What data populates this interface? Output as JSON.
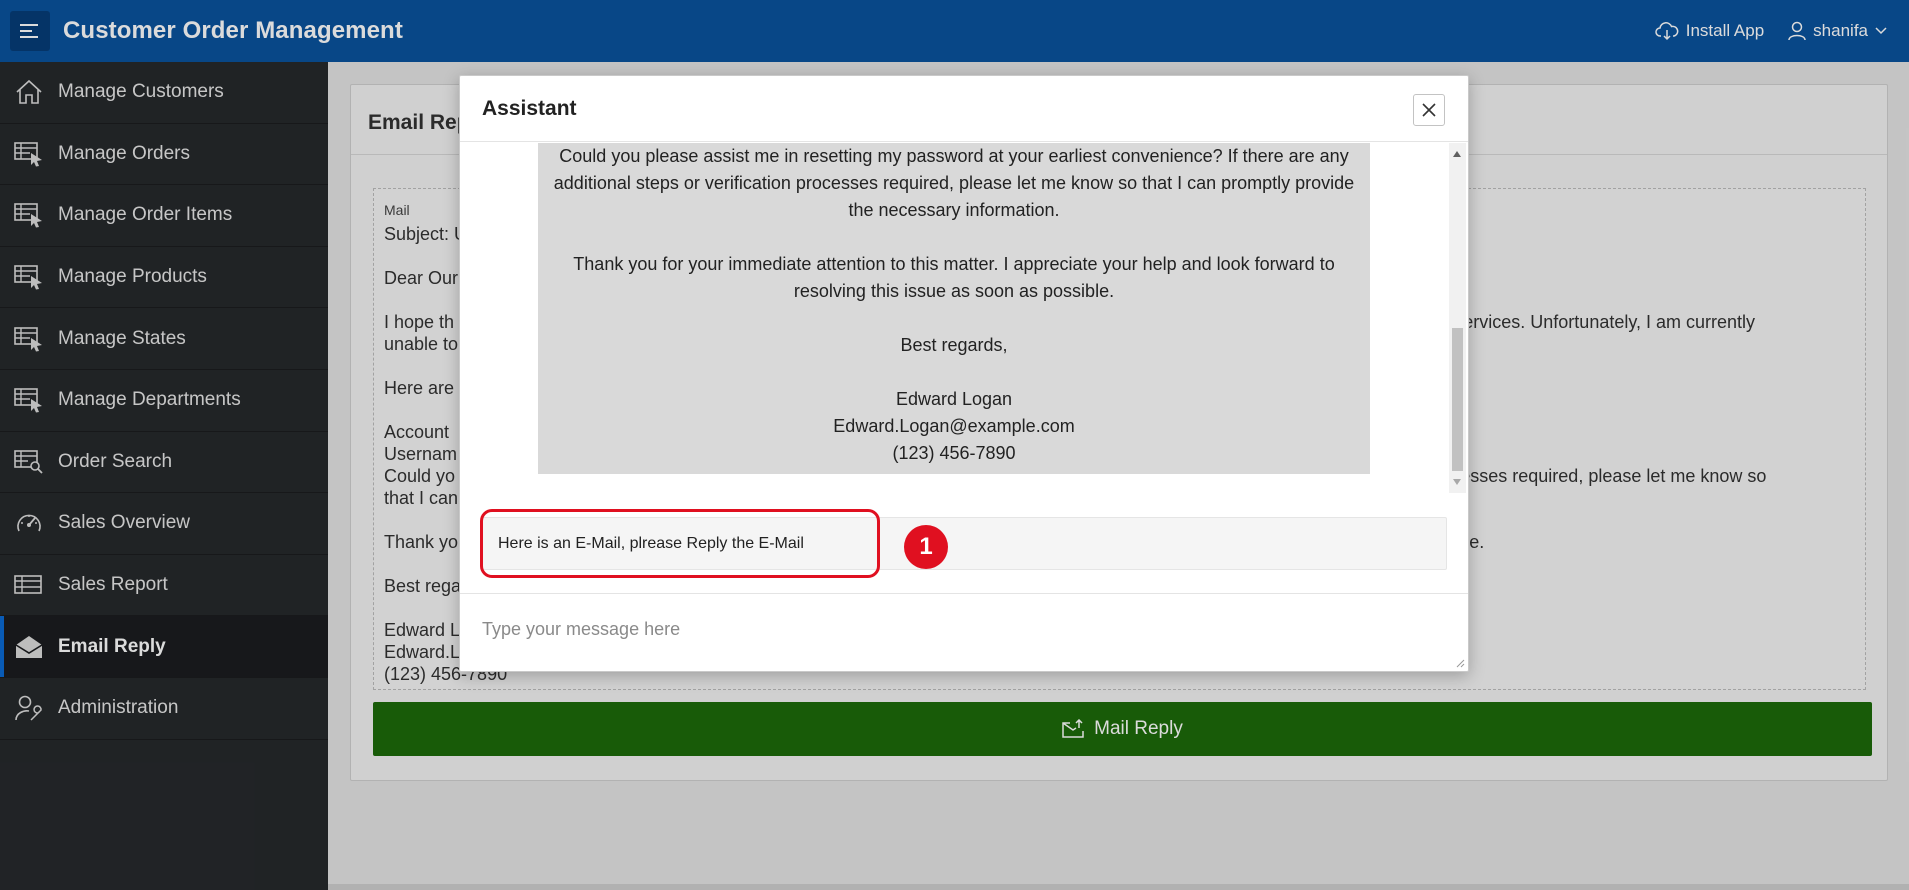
{
  "header": {
    "title": "Customer Order Management",
    "install_app": "Install App",
    "user": "shanifa"
  },
  "sidebar": {
    "items": [
      {
        "label": "Manage Customers",
        "icon": "home-icon"
      },
      {
        "label": "Manage Orders",
        "icon": "table-pointer-icon"
      },
      {
        "label": "Manage Order Items",
        "icon": "table-pointer-icon"
      },
      {
        "label": "Manage Products",
        "icon": "table-pointer-icon"
      },
      {
        "label": "Manage States",
        "icon": "table-pointer-icon"
      },
      {
        "label": "Manage Departments",
        "icon": "table-pointer-icon"
      },
      {
        "label": "Order Search",
        "icon": "table-search-icon"
      },
      {
        "label": "Sales Overview",
        "icon": "gauge-icon"
      },
      {
        "label": "Sales Report",
        "icon": "table-icon"
      },
      {
        "label": "Email Reply",
        "icon": "envelope-open-icon",
        "active": true
      },
      {
        "label": "Administration",
        "icon": "user-wrench-icon"
      }
    ]
  },
  "main": {
    "region_title": "Email Repl",
    "mail_label": "Mail",
    "mail_lines": [
      "Subject: U",
      "",
      "Dear Our",
      "",
      "I hope th                                                                                                                                                                                             h your services. Unfortunately, I am currently",
      "unable to",
      "",
      "Here are",
      "",
      "Account",
      "Usernam",
      "Could yo                                                                                                                                                                                               n processes required, please let me know so",
      "that I can",
      "",
      "Thank yo                                                                                                                                                                                               possible.",
      "",
      "Best rega",
      "",
      "Edward L",
      "Edward.L",
      "(123) 456-7890"
    ],
    "mail_reply_button": "Mail Reply"
  },
  "dialog": {
    "title": "Assistant",
    "close_label": "×",
    "reply_paragraphs": [
      "Could you please assist me in resetting my password at your earliest convenience? If there are any additional steps or verification processes required, please let me know so that I can promptly provide the necessary information.",
      "Thank you for your immediate attention to this matter. I appreciate your help and look forward to resolving this issue as soon as possible.",
      "Best regards,",
      "Edward Logan",
      "Edward.Logan@example.com",
      "(123) 456-7890"
    ],
    "user_message": "Here is an E-Mail, plrease Reply the E-Mail",
    "input_placeholder": "Type your message here",
    "annotation_number": "1"
  },
  "colors": {
    "header_bg": "#0a539e",
    "sidebar_bg": "#26292c",
    "button_green": "#1c6b0a",
    "annotation_red": "#e01020"
  }
}
